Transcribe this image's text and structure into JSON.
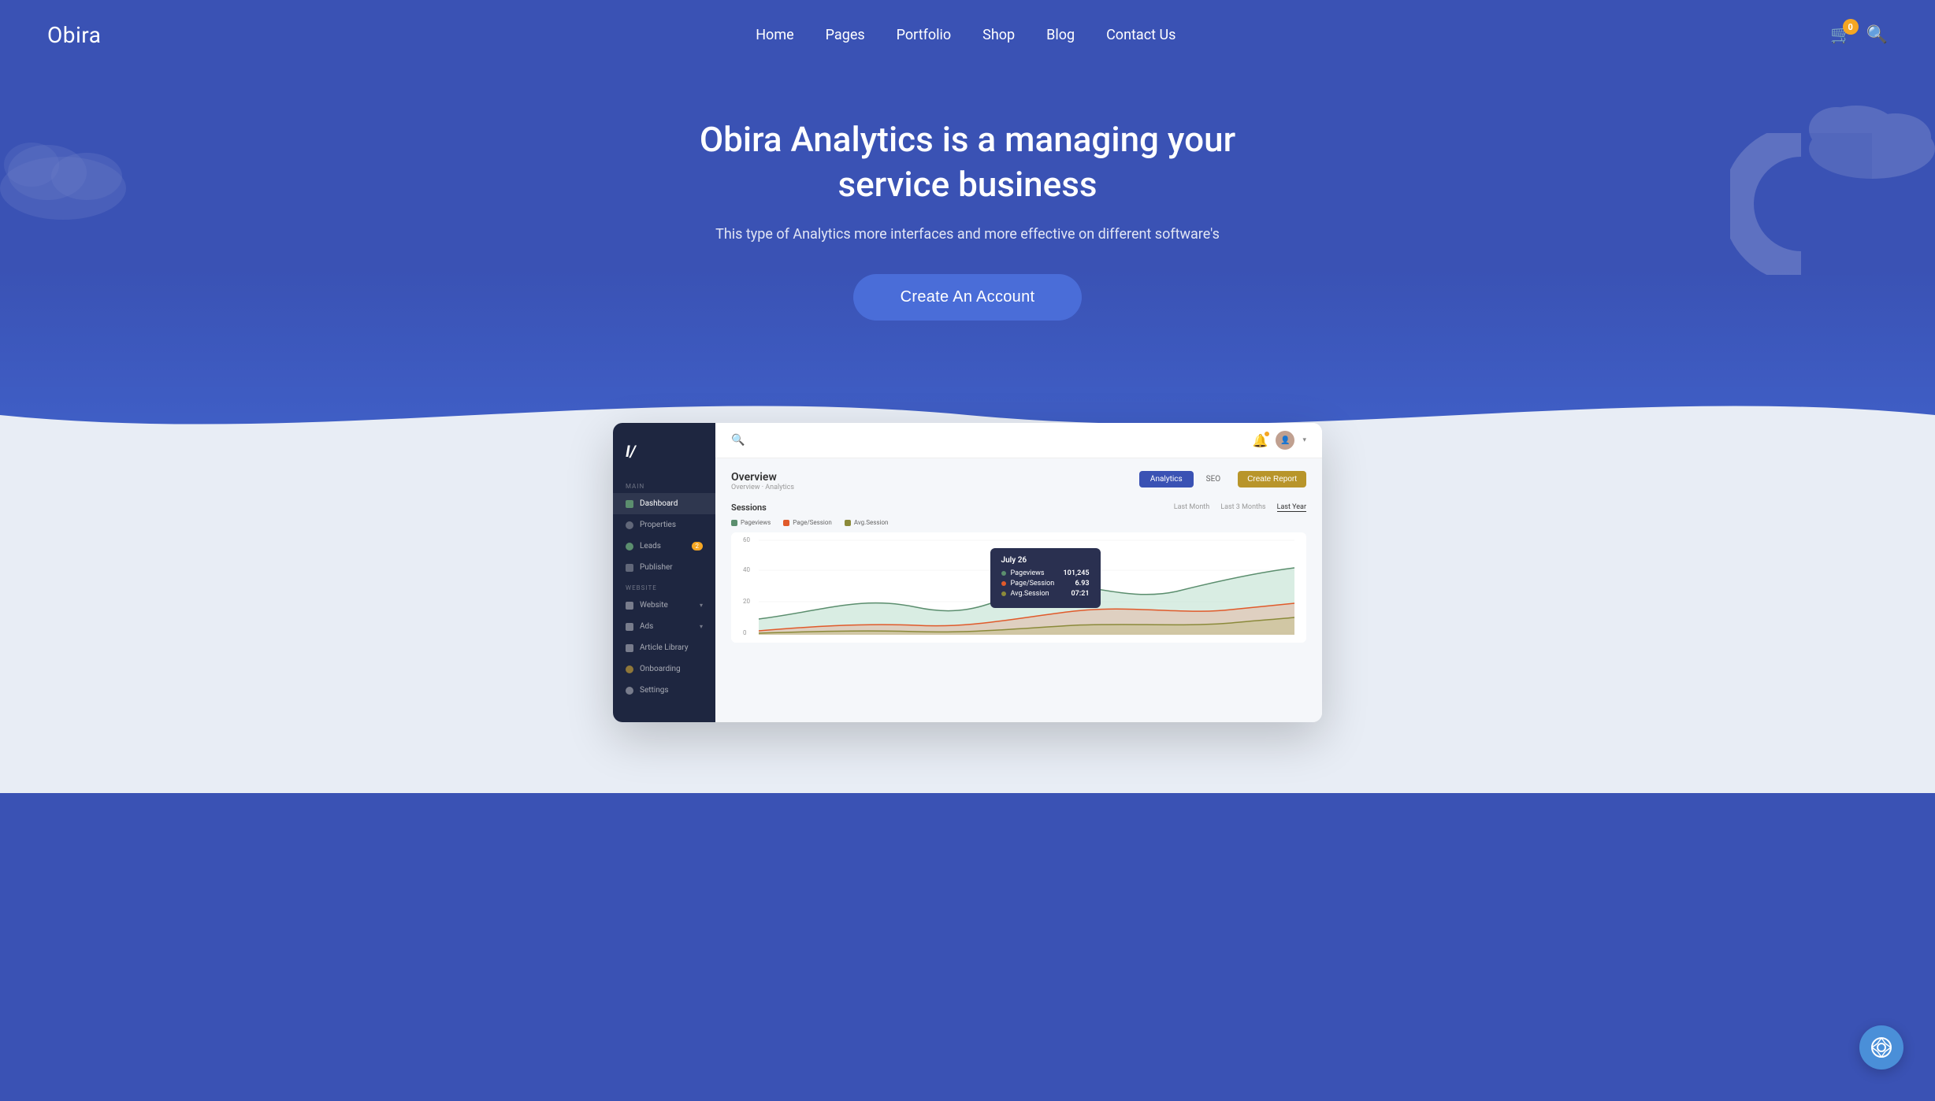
{
  "header": {
    "logo": "Obira",
    "nav": {
      "items": [
        {
          "label": "Home",
          "id": "home"
        },
        {
          "label": "Pages",
          "id": "pages"
        },
        {
          "label": "Portfolio",
          "id": "portfolio"
        },
        {
          "label": "Shop",
          "id": "shop"
        },
        {
          "label": "Blog",
          "id": "blog"
        },
        {
          "label": "Contact Us",
          "id": "contact"
        }
      ]
    },
    "cart_count": "0",
    "cart_icon": "🛒",
    "search_icon": "🔍"
  },
  "hero": {
    "title": "Obira Analytics is a managing your service business",
    "subtitle": "This type of Analytics more interfaces and more effective on different software's",
    "cta_label": "Create An Account"
  },
  "dashboard": {
    "logo": "I/",
    "sidebar": {
      "main_label": "MAIN",
      "items": [
        {
          "label": "Dashboard",
          "id": "dashboard",
          "active": true
        },
        {
          "label": "Properties",
          "id": "properties"
        },
        {
          "label": "Leads",
          "id": "leads",
          "badge": "2"
        },
        {
          "label": "Publisher",
          "id": "publisher"
        }
      ],
      "website_label": "WEBSITE",
      "website_items": [
        {
          "label": "Website",
          "id": "website",
          "has_arrow": true
        },
        {
          "label": "Ads",
          "id": "ads",
          "has_arrow": true
        },
        {
          "label": "Article Library",
          "id": "article-library"
        },
        {
          "label": "Onboarding",
          "id": "onboarding"
        },
        {
          "label": "Settings",
          "id": "settings"
        }
      ]
    },
    "topbar": {
      "search_placeholder": "Search"
    },
    "content": {
      "title": "Overview",
      "subtitle": "Overview · Analytics",
      "tabs": [
        {
          "label": "Analytics",
          "active": true
        },
        {
          "label": "SEO"
        }
      ],
      "create_report": "Create Report",
      "sessions": {
        "title": "Sessions",
        "time_filters": [
          "Last Month",
          "Last 3 Months",
          "Last Year"
        ],
        "active_filter": "Last Year",
        "legend": [
          {
            "label": "Pageviews",
            "color": "#5b8e6e"
          },
          {
            "label": "Page/Session",
            "color": "#e05a2b"
          },
          {
            "label": "Avg.Session",
            "color": "#8b8a3a"
          }
        ]
      },
      "y_axis": [
        "60",
        "40",
        "20",
        "0"
      ],
      "tooltip": {
        "date": "July 26",
        "rows": [
          {
            "label": "Pageviews",
            "value": "101,245",
            "color": "#5b8e6e"
          },
          {
            "label": "Page/Session",
            "value": "6.93",
            "color": "#e05a2b"
          },
          {
            "label": "Avg.Session",
            "value": "07:21",
            "color": "#8b8a3a"
          }
        ]
      }
    }
  },
  "support": {
    "icon": "⊛",
    "label": "Support"
  }
}
